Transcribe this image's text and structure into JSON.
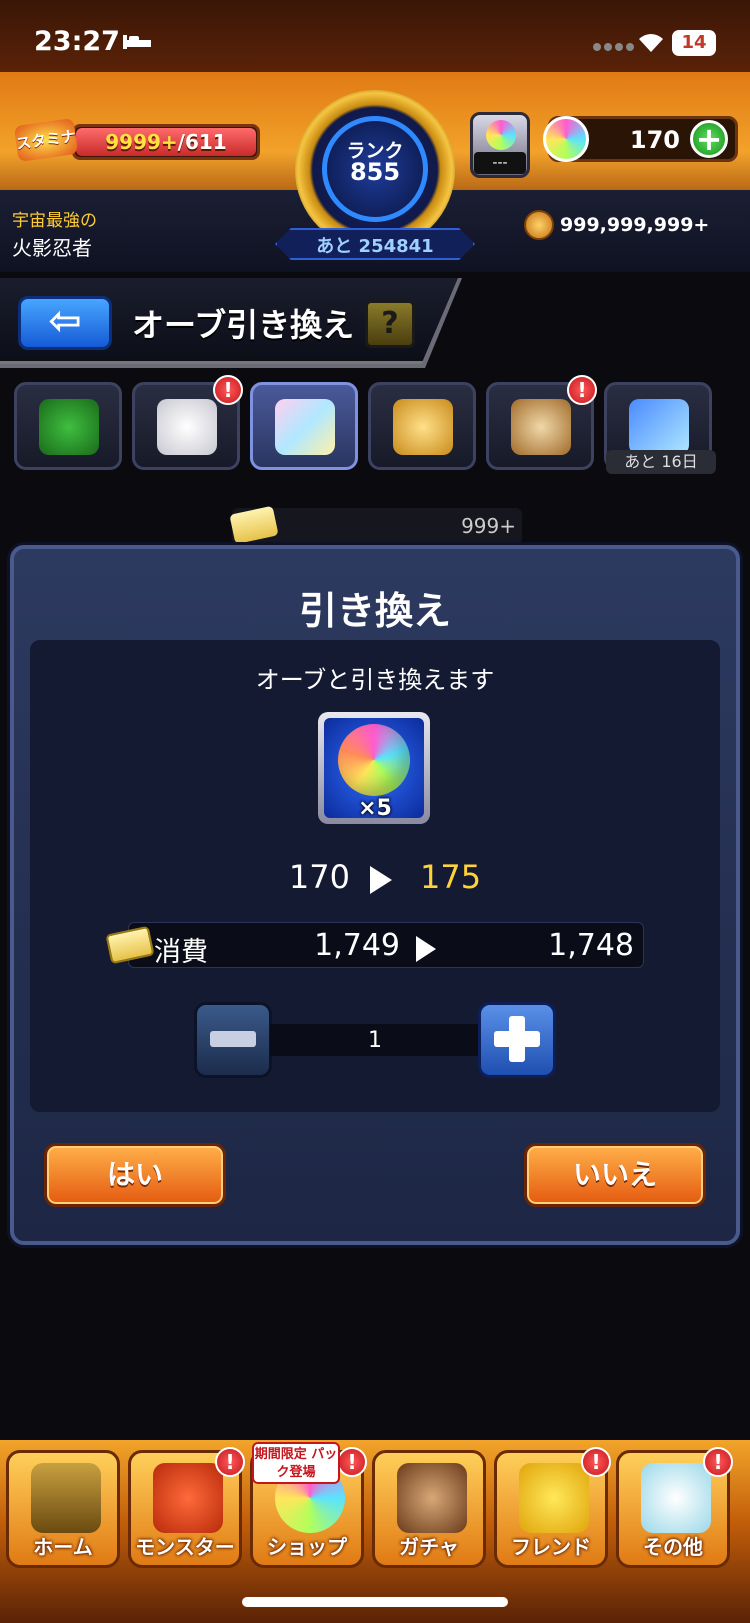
{
  "status_bar": {
    "time": "23:27",
    "battery": "14"
  },
  "header": {
    "stamina_label": "スタミナ",
    "stamina_current": "9999+",
    "stamina_max": "/611",
    "player_title_line1": "宇宙最強の",
    "player_title_line2": "火影忍者",
    "rank_label": "ランク",
    "rank_value": "855",
    "rank_remaining": "あと 254841",
    "orb_container_label": "---",
    "orb_count": "170",
    "coin_count": "999,999,999+"
  },
  "page": {
    "title": "オーブ引き換え",
    "help_label": "?"
  },
  "tabs": {
    "remaining_days": "あと 16日"
  },
  "ticket_row": {
    "count": "999+"
  },
  "dialog": {
    "title": "引き換え",
    "message": "オーブと引き換えます",
    "item_quantity": "×5",
    "orb_before": "170",
    "orb_after": "175",
    "cost_label": "消費",
    "cost_before": "1,749",
    "cost_after": "1,748",
    "quantity_value": "1",
    "yes_label": "はい",
    "no_label": "いいえ"
  },
  "bottom_nav": {
    "home": "ホーム",
    "monster": "モンスター",
    "shop": "ショップ",
    "gacha": "ガチャ",
    "friend": "フレンド",
    "other": "その他",
    "limited_banner": "期間限定 パック登場",
    "alert_mark": "!"
  }
}
